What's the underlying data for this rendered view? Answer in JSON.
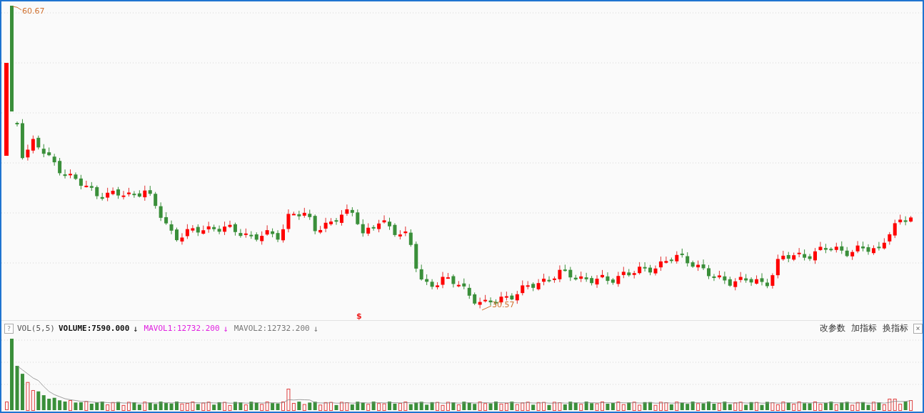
{
  "chart": {
    "high_label": "60.67",
    "low_label": "30.57",
    "marker": "$"
  },
  "indicator_bar": {
    "help": "?",
    "name": "VOL(5,5)",
    "values": [
      {
        "kind": "volume",
        "text": "VOLUME:7590.000",
        "arrow": "↓"
      },
      {
        "kind": "mavol1",
        "text": "MAVOL1:12732.200",
        "arrow": "↓"
      },
      {
        "kind": "mavol2",
        "text": "MAVOL2:12732.200",
        "arrow": "↓"
      }
    ],
    "actions": [
      "改参数",
      "加指标",
      "换指标"
    ],
    "close": "×"
  }
}
